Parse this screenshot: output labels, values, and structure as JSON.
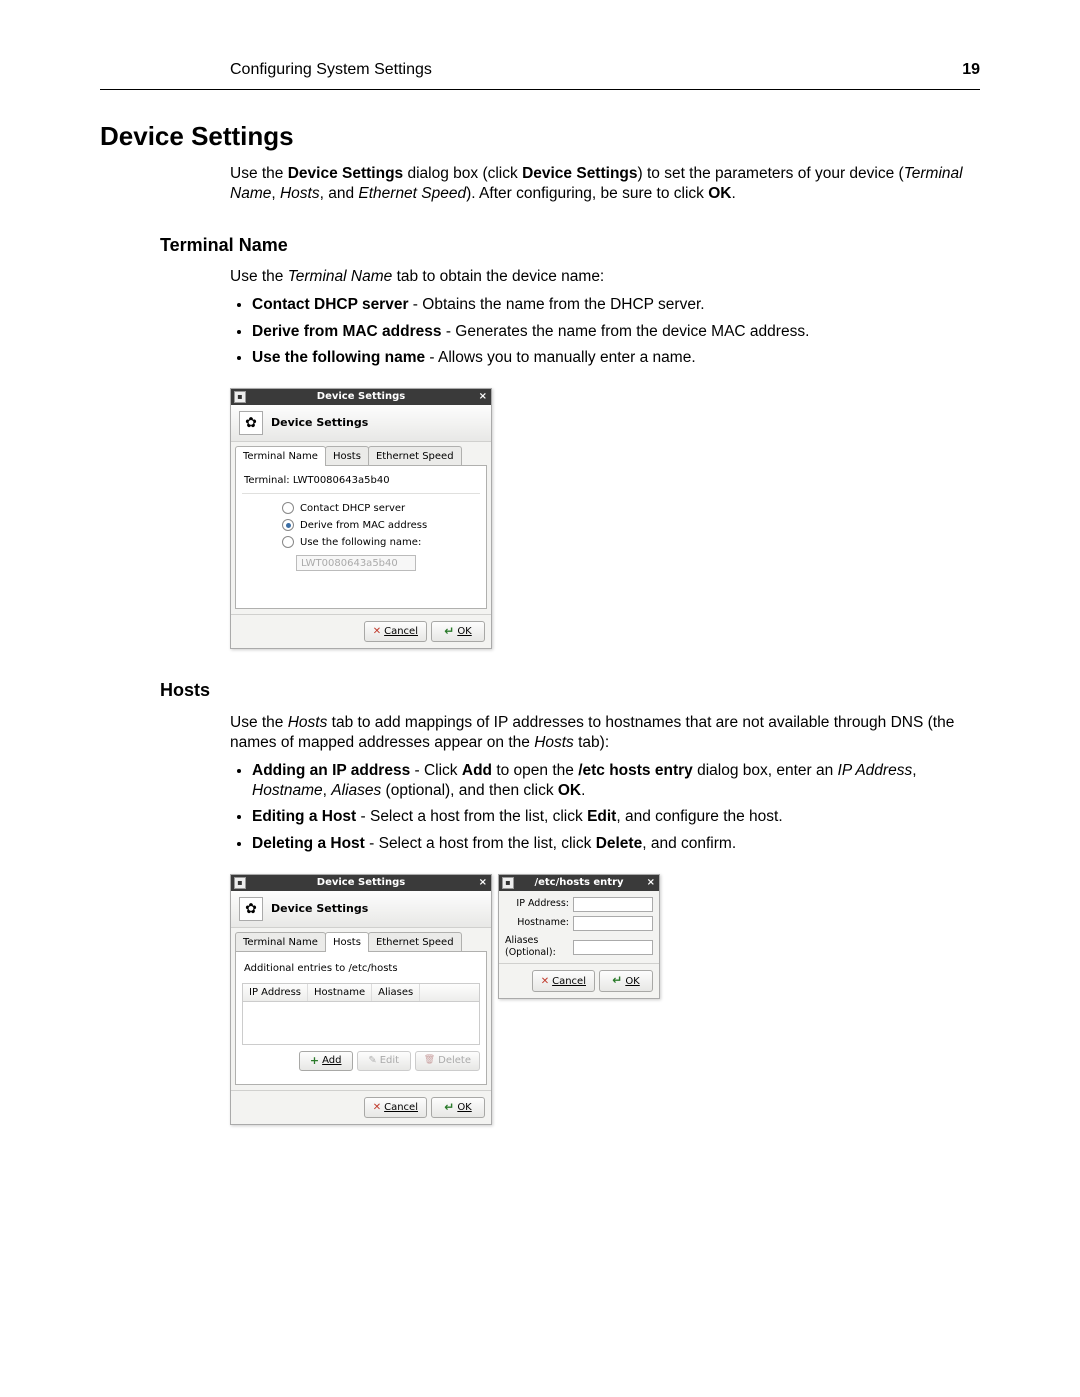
{
  "running_header": {
    "left": "Configuring System Settings",
    "page_number": "19"
  },
  "section_title": "Device Settings",
  "intro": {
    "prefix": "Use the ",
    "bold1": "Device Settings",
    "mid1": " dialog box (click ",
    "bold2": "Device Settings",
    "mid2": ") to set the parameters of your device (",
    "ital1": "Terminal Name",
    "sep1": ", ",
    "ital2": "Hosts",
    "sep2": ", and ",
    "ital3": "Ethernet Speed",
    "mid3": "). After configuring, be sure to click ",
    "bold3": "OK",
    "end": "."
  },
  "terminal_name": {
    "heading": "Terminal Name",
    "lead_prefix": "Use the ",
    "lead_ital": "Terminal Name",
    "lead_suffix": " tab to obtain the device name:",
    "bullets": [
      {
        "bold": "Contact DHCP server",
        "rest": " - Obtains the name from the DHCP server."
      },
      {
        "bold": "Derive from MAC address",
        "rest": " - Generates the name from the device MAC address."
      },
      {
        "bold": "Use the following name",
        "rest": " - Allows you to manually enter a name."
      }
    ]
  },
  "hosts": {
    "heading": "Hosts",
    "lead_prefix": "Use the ",
    "lead_ital": "Hosts",
    "lead_mid": " tab to add mappings of IP addresses to hostnames that are not available through DNS (the names of mapped addresses appear on the ",
    "lead_ital2": "Hosts",
    "lead_suffix": " tab):",
    "bullets": {
      "b1": {
        "bold1": "Adding an IP address",
        "t1": " - Click ",
        "bold2": "Add",
        "t2": " to open the ",
        "bold3": "/etc hosts entry",
        "t3": " dialog box, enter an ",
        "ital1": "IP Address",
        "sep1": ", ",
        "ital2": "Hostname",
        "sep2": ", ",
        "ital3": "Aliases",
        "t4": " (optional), and then click ",
        "bold4": "OK",
        "end": "."
      },
      "b2": {
        "bold1": "Editing a Host",
        "t1": " - Select a host from the list, click ",
        "bold2": "Edit",
        "t2": ", and configure the host."
      },
      "b3": {
        "bold1": "Deleting a Host",
        "t1": " - Select a host from the list, click ",
        "bold2": "Delete",
        "t2": ", and confirm."
      }
    }
  },
  "dialog1": {
    "titlebar": "Device Settings",
    "header_title": "Device Settings",
    "tabs": {
      "t1": "Terminal Name",
      "t2": "Hosts",
      "t3": "Ethernet Speed"
    },
    "terminal_label_prefix": "Terminal: ",
    "terminal_value": "LWT0080643a5b40",
    "radios": {
      "r1": "Contact DHCP server",
      "r2": "Derive from MAC address",
      "r3": "Use the following name:"
    },
    "name_input_placeholder": "LWT0080643a5b40",
    "cancel": "Cancel",
    "ok": "OK"
  },
  "dialog2": {
    "titlebar": "Device Settings",
    "header_title": "Device Settings",
    "tabs": {
      "t1": "Terminal Name",
      "t2": "Hosts",
      "t3": "Ethernet Speed"
    },
    "caption": "Additional entries to /etc/hosts",
    "cols": {
      "c1": "IP Address",
      "c2": "Hostname",
      "c3": "Aliases"
    },
    "add": "Add",
    "edit": "Edit",
    "delete": "Delete",
    "cancel": "Cancel",
    "ok": "OK"
  },
  "dialog3": {
    "titlebar": "/etc/hosts entry",
    "fields": {
      "ip": "IP Address:",
      "host": "Hostname:",
      "aliases": "Aliases (Optional):"
    },
    "cancel": "Cancel",
    "ok": "OK"
  }
}
